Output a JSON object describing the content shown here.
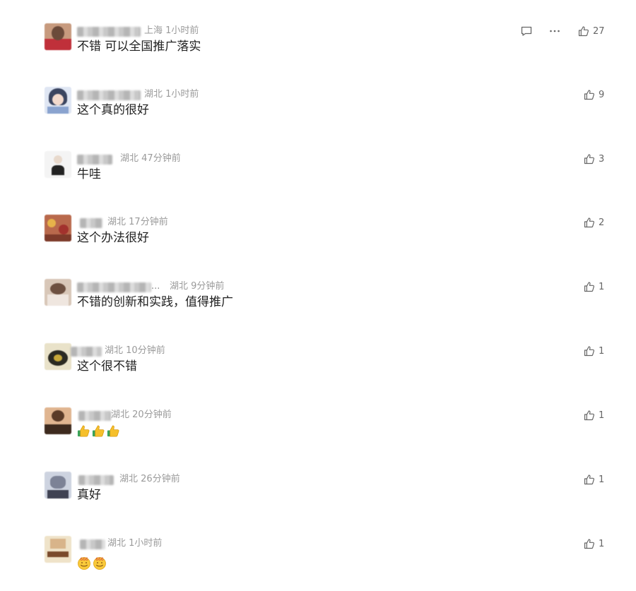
{
  "comments": [
    {
      "location": "上海",
      "time": "1小时前",
      "text": "不错 可以全国推广落实",
      "likes": "27",
      "name_dots": ""
    },
    {
      "location": "湖北",
      "time": "1小时前",
      "text": "这个真的很好",
      "likes": "9",
      "name_dots": ""
    },
    {
      "location": "湖北",
      "time": "47分钟前",
      "text": "牛哇",
      "likes": "3",
      "name_dots": ""
    },
    {
      "location": "湖北",
      "time": "17分钟前",
      "text": "这个办法很好",
      "likes": "2",
      "name_dots": ""
    },
    {
      "location": "湖北",
      "time": "9分钟前",
      "text": "不错的创新和实践，值得推广",
      "likes": "1",
      "name_dots": "..."
    },
    {
      "location": "湖北",
      "time": "10分钟前",
      "text": "这个很不错",
      "likes": "1",
      "name_dots": ""
    },
    {
      "location": "湖北",
      "time": "20分钟前",
      "text": "",
      "likes": "1",
      "name_dots": "",
      "emoji": [
        "thumbs-up",
        "thumbs-up",
        "thumbs-up"
      ]
    },
    {
      "location": "湖北",
      "time": "26分钟前",
      "text": "真好",
      "likes": "1",
      "name_dots": ""
    },
    {
      "location": "湖北",
      "time": "1小时前",
      "text": "",
      "likes": "1",
      "name_dots": "",
      "emoji": [
        "666-face",
        "666-face"
      ]
    }
  ],
  "icons": {
    "reply": "reply-icon",
    "more": "more-icon",
    "like": "thumbs-up-icon"
  },
  "colors": {
    "meta_text": "#9a9a9a",
    "comment_text": "#222222",
    "like_icon": "#666666"
  }
}
